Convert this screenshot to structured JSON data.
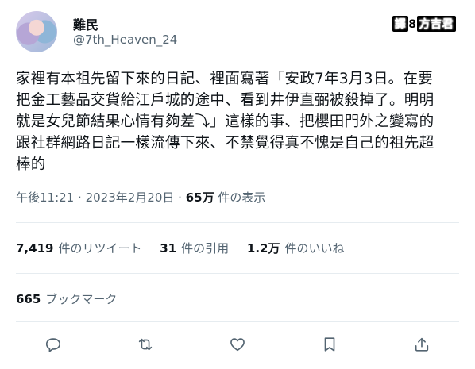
{
  "author": {
    "display_name": "難民",
    "handle": "@7th_Heaven_24"
  },
  "badge": {
    "prefix": "譯",
    "number": "8",
    "suffix": "方吉君"
  },
  "tweet": {
    "text": "家裡有本祖先留下來的日記、裡面寫著「安政7年3月3日。在要\n把金工藝品交貨給江戶城的途中、看到井伊直弼被殺掉了。明明\n就是女兒節結果心情有夠差⤵」這樣的事、把櫻田門外之變寫的\n跟社群網路日記一樣流傳下來、不禁覺得真不愧是自己的祖先超\n棒的"
  },
  "meta": {
    "time": "午後11:21",
    "separator": "·",
    "date": "2023年2月20日",
    "views_count": "65万",
    "views_label": "件の表示"
  },
  "stats": {
    "retweets_count": "7,419",
    "retweets_label": "件のリツイート",
    "quotes_count": "31",
    "quotes_label": "件の引用",
    "likes_count": "1.2万",
    "likes_label": "件のいいね",
    "bookmarks_count": "665",
    "bookmarks_label": "ブックマーク"
  },
  "actions": {
    "reply_icon": "reply-icon",
    "retweet_icon": "retweet-icon",
    "like_icon": "heart-icon",
    "bookmark_icon": "bookmark-icon",
    "share_icon": "share-icon"
  }
}
